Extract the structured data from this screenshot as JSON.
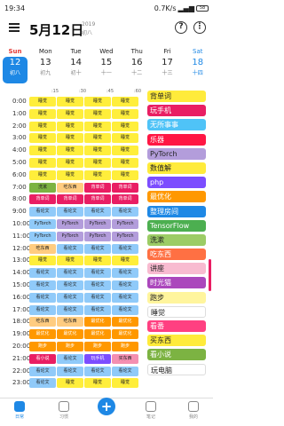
{
  "status": {
    "time": "19:34",
    "right": "0.7K/s",
    "battery": "58"
  },
  "header": {
    "title": "5月12日",
    "year": "2019",
    "lunar": "初八"
  },
  "week": [
    {
      "name": "Sun",
      "date": "12",
      "lunar": "初八",
      "selected": true,
      "kind": "sun"
    },
    {
      "name": "Mon",
      "date": "13",
      "lunar": "初九",
      "kind": ""
    },
    {
      "name": "Tue",
      "date": "14",
      "lunar": "初十",
      "kind": ""
    },
    {
      "name": "Wed",
      "date": "15",
      "lunar": "十一",
      "kind": ""
    },
    {
      "name": "Thu",
      "date": "16",
      "lunar": "十二",
      "kind": ""
    },
    {
      "name": "Fri",
      "date": "17",
      "lunar": "十三",
      "kind": ""
    },
    {
      "name": "Sat",
      "date": "18",
      "lunar": "十四",
      "kind": "sat"
    }
  ],
  "ticks": [
    ":15",
    ":30",
    ":45",
    ":60"
  ],
  "colors": {
    "sleep": "#ffee3b",
    "study": "#90caf9",
    "pytorch": "#b39ddb",
    "eat": "#ff5722",
    "shower": "#ffcc80",
    "gym": "#ff7043",
    "walk": "#ff9800",
    "game": "#7c4dff",
    "rose": "#f48fb1",
    "pink": "#e91e63",
    "green": "#7cb342"
  },
  "rows": [
    {
      "time": "0:00",
      "slots": [
        [
          "睡觉",
          "sleep"
        ],
        [
          "睡觉",
          "sleep"
        ],
        [
          "睡觉",
          "sleep"
        ],
        [
          "睡觉",
          "sleep"
        ]
      ]
    },
    {
      "time": "1:00",
      "slots": [
        [
          "睡觉",
          "sleep"
        ],
        [
          "睡觉",
          "sleep"
        ],
        [
          "睡觉",
          "sleep"
        ],
        [
          "睡觉",
          "sleep"
        ]
      ]
    },
    {
      "time": "2:00",
      "slots": [
        [
          "睡觉",
          "sleep"
        ],
        [
          "睡觉",
          "sleep"
        ],
        [
          "睡觉",
          "sleep"
        ],
        [
          "睡觉",
          "sleep"
        ]
      ]
    },
    {
      "time": "3:00",
      "slots": [
        [
          "睡觉",
          "sleep"
        ],
        [
          "睡觉",
          "sleep"
        ],
        [
          "睡觉",
          "sleep"
        ],
        [
          "睡觉",
          "sleep"
        ]
      ]
    },
    {
      "time": "4:00",
      "slots": [
        [
          "睡觉",
          "sleep"
        ],
        [
          "睡觉",
          "sleep"
        ],
        [
          "睡觉",
          "sleep"
        ],
        [
          "睡觉",
          "sleep"
        ]
      ]
    },
    {
      "time": "5:00",
      "slots": [
        [
          "睡觉",
          "sleep"
        ],
        [
          "睡觉",
          "sleep"
        ],
        [
          "睡觉",
          "sleep"
        ],
        [
          "睡觉",
          "sleep"
        ]
      ]
    },
    {
      "time": "6:00",
      "slots": [
        [
          "睡觉",
          "sleep"
        ],
        [
          "睡觉",
          "sleep"
        ],
        [
          "睡觉",
          "sleep"
        ],
        [
          "睡觉",
          "sleep"
        ]
      ]
    },
    {
      "time": "7:00",
      "slots": [
        [
          "洗漱",
          "green"
        ],
        [
          "吃东西",
          "shower"
        ],
        [
          "背单词",
          "pink"
        ],
        [
          "背单词",
          "pink"
        ]
      ]
    },
    {
      "time": "8:00",
      "slots": [
        [
          "背单词",
          "pink"
        ],
        [
          "背单词",
          "pink"
        ],
        [
          "背单词",
          "pink"
        ],
        [
          "背单词",
          "pink"
        ]
      ]
    },
    {
      "time": "9:00",
      "slots": [
        [
          "看论文",
          "study"
        ],
        [
          "看论文",
          "study"
        ],
        [
          "看论文",
          "study"
        ],
        [
          "看论文",
          "study"
        ]
      ]
    },
    {
      "time": "10:00",
      "slots": [
        [
          "PyTorch",
          "study"
        ],
        [
          "PyTorch",
          "pytorch"
        ],
        [
          "PyTorch",
          "pytorch"
        ],
        [
          "PyTorch",
          "pytorch"
        ]
      ]
    },
    {
      "time": "11:00",
      "slots": [
        [
          "PyTorch",
          "study"
        ],
        [
          "PyTorch",
          "pytorch"
        ],
        [
          "PyTorch",
          "pytorch"
        ],
        [
          "PyTorch",
          "pytorch"
        ]
      ]
    },
    {
      "time": "12:00",
      "slots": [
        [
          "吃东西",
          "shower"
        ],
        [
          "看论文",
          "study"
        ],
        [
          "看论文",
          "study"
        ],
        [
          "看论文",
          "study"
        ]
      ]
    },
    {
      "time": "13:00",
      "slots": [
        [
          "睡觉",
          "sleep"
        ],
        [
          "睡觉",
          "sleep"
        ],
        [
          "睡觉",
          "sleep"
        ],
        [
          "睡觉",
          "sleep"
        ]
      ]
    },
    {
      "time": "14:00",
      "slots": [
        [
          "看论文",
          "study"
        ],
        [
          "看论文",
          "study"
        ],
        [
          "看论文",
          "study"
        ],
        [
          "看论文",
          "study"
        ]
      ]
    },
    {
      "time": "15:00",
      "slots": [
        [
          "看论文",
          "study"
        ],
        [
          "看论文",
          "study"
        ],
        [
          "看论文",
          "study"
        ],
        [
          "看论文",
          "study"
        ]
      ]
    },
    {
      "time": "16:00",
      "slots": [
        [
          "看论文",
          "study"
        ],
        [
          "看论文",
          "study"
        ],
        [
          "看论文",
          "study"
        ],
        [
          "看论文",
          "study"
        ]
      ]
    },
    {
      "time": "17:00",
      "slots": [
        [
          "看论文",
          "study"
        ],
        [
          "看论文",
          "study"
        ],
        [
          "看论文",
          "study"
        ],
        [
          "看论文",
          "study"
        ]
      ]
    },
    {
      "time": "18:00",
      "slots": [
        [
          "吃东西",
          "shower"
        ],
        [
          "吃东西",
          "shower"
        ],
        [
          "最优化",
          "walk"
        ],
        [
          "最优化",
          "walk"
        ]
      ]
    },
    {
      "time": "19:00",
      "slots": [
        [
          "最优化",
          "walk"
        ],
        [
          "最优化",
          "walk"
        ],
        [
          "最优化",
          "walk"
        ],
        [
          "最优化",
          "walk"
        ]
      ]
    },
    {
      "time": "20:00",
      "slots": [
        [
          "跑步",
          "walk"
        ],
        [
          "跑步",
          "walk"
        ],
        [
          "跑步",
          "walk"
        ],
        [
          "跑步",
          "walk"
        ]
      ]
    },
    {
      "time": "21:00",
      "slots": [
        [
          "看小说",
          "pink"
        ],
        [
          "看论文",
          "study"
        ],
        [
          "玩手机",
          "game"
        ],
        [
          "买东西",
          "rose"
        ]
      ]
    },
    {
      "time": "22:00",
      "slots": [
        [
          "看论文",
          "study"
        ],
        [
          "看论文",
          "study"
        ],
        [
          "看论文",
          "study"
        ],
        [
          "看论文",
          "study"
        ]
      ]
    },
    {
      "time": "23:00",
      "slots": [
        [
          "看论文",
          "study"
        ],
        [
          "睡觉",
          "sleep"
        ],
        [
          "睡觉",
          "sleep"
        ],
        [
          "睡觉",
          "sleep"
        ]
      ]
    }
  ],
  "legend": [
    {
      "label": "背单词",
      "bg": "#ffeb3b",
      "fg": "#222"
    },
    {
      "label": "玩手机",
      "bg": "#e91e63",
      "fg": "#fff"
    },
    {
      "label": "无所事事",
      "bg": "#4fc3f7",
      "fg": "#fff"
    },
    {
      "label": "乐器",
      "bg": "#ff1744",
      "fg": "#fff"
    },
    {
      "label": "PyTorch",
      "bg": "#b39ddb",
      "fg": "#222"
    },
    {
      "label": "数值解",
      "bg": "#ffeb3b",
      "fg": "#222"
    },
    {
      "label": "php",
      "bg": "#7c4dff",
      "fg": "#fff"
    },
    {
      "label": "最优化",
      "bg": "#ff9800",
      "fg": "#fff"
    },
    {
      "label": "整理房间",
      "bg": "#1e88e5",
      "fg": "#fff"
    },
    {
      "label": "TensorFlow",
      "bg": "#4caf50",
      "fg": "#fff"
    },
    {
      "label": "洗漱",
      "bg": "#9ccc65",
      "fg": "#222"
    },
    {
      "label": "吃东西",
      "bg": "#ff7043",
      "fg": "#fff"
    },
    {
      "label": "讲座",
      "bg": "#f8bbd0",
      "fg": "#222"
    },
    {
      "label": "时光猫",
      "bg": "#ab47bc",
      "fg": "#fff"
    },
    {
      "label": "跑步",
      "bg": "#fff59d",
      "fg": "#222"
    },
    {
      "label": "睡觉",
      "bg": "#ffffff",
      "fg": "#222"
    },
    {
      "label": "看番",
      "bg": "#ff4081",
      "fg": "#fff"
    },
    {
      "label": "买东西",
      "bg": "#ffeb3b",
      "fg": "#222"
    },
    {
      "label": "看小说",
      "bg": "#7cb342",
      "fg": "#fff"
    },
    {
      "label": "玩电脑",
      "bg": "#ffffff",
      "fg": "#222"
    }
  ],
  "nav": [
    {
      "label": "日常",
      "active": true
    },
    {
      "label": "习惯",
      "active": false
    },
    {
      "label": "笔记",
      "active": false
    },
    {
      "label": "我的",
      "active": false
    }
  ]
}
